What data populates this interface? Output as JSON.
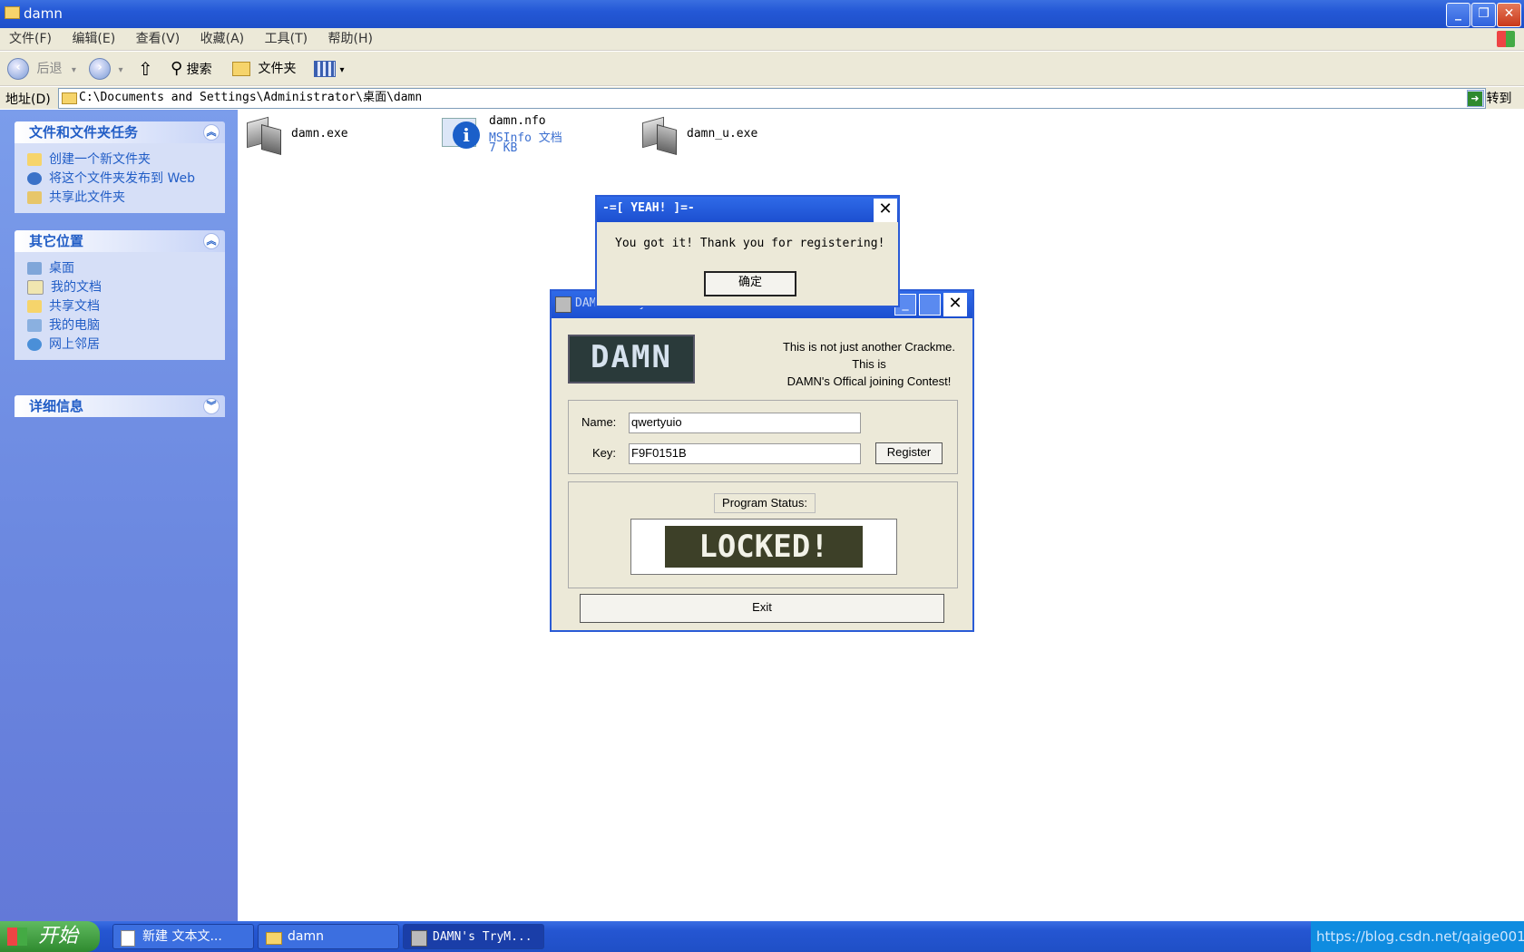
{
  "window": {
    "title": "damn"
  },
  "menu": [
    "文件(F)",
    "编辑(E)",
    "查看(V)",
    "收藏(A)",
    "工具(T)",
    "帮助(H)"
  ],
  "toolbar": {
    "back": "后退",
    "search": "搜索",
    "folders": "文件夹"
  },
  "address": {
    "label": "地址(D)",
    "path": "C:\\Documents and Settings\\Administrator\\桌面\\damn",
    "go": "转到"
  },
  "panels": {
    "tasks": {
      "title": "文件和文件夹任务",
      "items": [
        "创建一个新文件夹",
        "将这个文件夹发布到 Web",
        "共享此文件夹"
      ]
    },
    "places": {
      "title": "其它位置",
      "items": [
        "桌面",
        "我的文档",
        "共享文档",
        "我的电脑",
        "网上邻居"
      ]
    },
    "details": {
      "title": "详细信息"
    }
  },
  "files": [
    {
      "name": "damn.exe"
    },
    {
      "name": "damn.nfo",
      "type": "MSInfo 文档",
      "size": "7 KB"
    },
    {
      "name": "damn_u.exe"
    }
  ],
  "crackme": {
    "title": "DAMN's TryMe - LOCKED!",
    "logo": "DAMN",
    "blurb1": "This is not just another Crackme.",
    "blurb2": "This is",
    "blurb3": "DAMN's Offical joining Contest!",
    "name_label": "Name:",
    "name_value": "qwertyuio",
    "key_label": "Key:",
    "key_value": "F9F0151B",
    "register": "Register",
    "status_label": "Program Status:",
    "status_image": "LOCKED!",
    "exit": "Exit"
  },
  "msgbox": {
    "title": "-=[ YEAH! ]=-",
    "message": "You got it! Thank you for registering!",
    "ok": "确定"
  },
  "taskbar": {
    "start": "开始",
    "tasks": [
      "新建 文本文...",
      "damn",
      "DAMN's TryM..."
    ],
    "watermark": "https://blog.csdn.net/qaige001"
  }
}
